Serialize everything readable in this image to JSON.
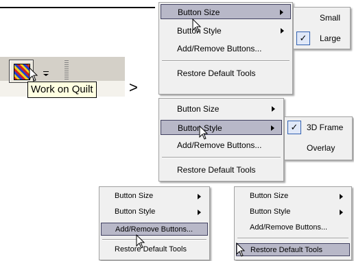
{
  "tooltip": {
    "text": "Work on Quilt"
  },
  "separator_symbol": ">",
  "menu1": {
    "items": [
      "Button Size",
      "Button Style",
      "Add/Remove Buttons...",
      "Restore Default Tools"
    ],
    "submenu": {
      "items": [
        "Small",
        "Large"
      ],
      "checked": "Large"
    }
  },
  "menu2": {
    "items": [
      "Button Size",
      "Button Style",
      "Add/Remove Buttons...",
      "Restore Default Tools"
    ],
    "submenu": {
      "items": [
        "3D Frame",
        "Overlay"
      ],
      "checked": "3D Frame"
    }
  },
  "menu3": {
    "items": [
      "Button Size",
      "Button Style",
      "Add/Remove Buttons...",
      "Restore Default Tools"
    ]
  },
  "menu4": {
    "items": [
      "Button Size",
      "Button Style",
      "Add/Remove Buttons...",
      "Restore Default Tools"
    ]
  },
  "check_mark": "✓",
  "colors": {
    "highlight": "#b8b8c8",
    "tooltip_bg": "#ffffe1",
    "menu_bg": "#f0f0f0"
  }
}
